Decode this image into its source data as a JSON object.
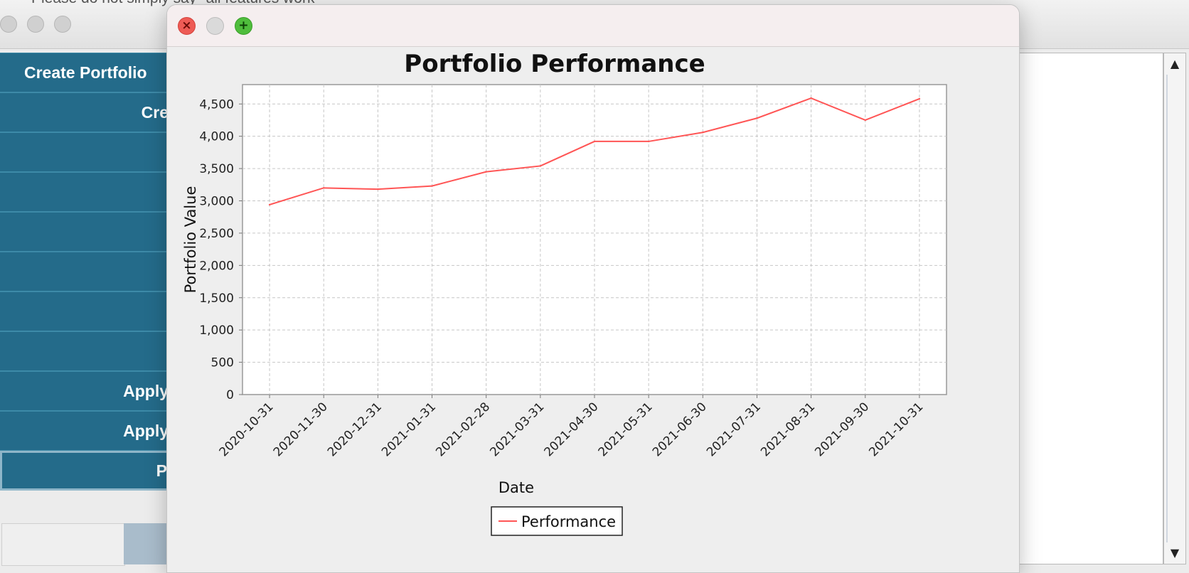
{
  "background_window": {
    "title_fragment": "Please do not simply say \"all features work\"",
    "sidebar_buttons": [
      "Create Portfolio",
      "Cre",
      "",
      "",
      "",
      "",
      "",
      "",
      "Apply",
      "Apply",
      "P"
    ]
  },
  "dialog": {
    "window_controls": {
      "close": "×",
      "zoom": "+"
    }
  },
  "chart_data": {
    "type": "line",
    "title": "Portfolio Performance",
    "xlabel": "Date",
    "ylabel": "Portfolio Value",
    "categories": [
      "2020-10-31",
      "2020-11-30",
      "2020-12-31",
      "2021-01-31",
      "2021-02-28",
      "2021-03-31",
      "2021-04-30",
      "2021-05-31",
      "2021-06-30",
      "2021-07-31",
      "2021-08-31",
      "2021-09-30",
      "2021-10-31"
    ],
    "series": [
      {
        "name": "Performance",
        "color": "#ff5555",
        "values": [
          2940,
          3200,
          3180,
          3230,
          3450,
          3540,
          3920,
          3920,
          4060,
          4280,
          4590,
          4250,
          4580
        ]
      }
    ],
    "ylim": [
      0,
      4800
    ],
    "yticks": [
      0,
      500,
      1000,
      1500,
      2000,
      2500,
      3000,
      3500,
      4000,
      4500
    ],
    "ytick_labels": [
      "0",
      "500",
      "1,000",
      "1,500",
      "2,000",
      "2,500",
      "3,000",
      "3,500",
      "4,000",
      "4,500"
    ],
    "grid": true,
    "legend": "bottom-center"
  }
}
